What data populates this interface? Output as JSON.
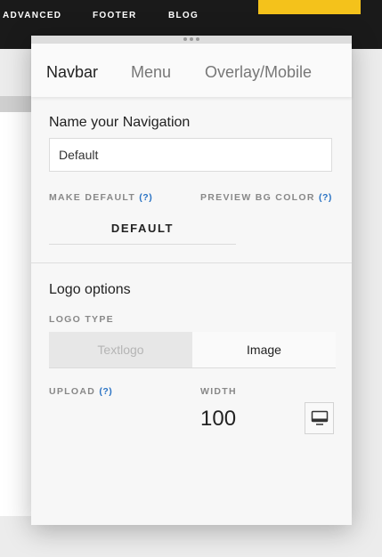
{
  "background": {
    "nav_items": [
      "ADVANCED",
      "FOOTER",
      "BLOG"
    ],
    "accent_color": "#f4c21b",
    "topbar_color": "#1a1a1a"
  },
  "panel": {
    "tabs": [
      {
        "label": "Navbar",
        "active": true
      },
      {
        "label": "Menu",
        "active": false
      },
      {
        "label": "Overlay/Mobile",
        "active": false
      }
    ],
    "navigation": {
      "heading": "Name your Navigation",
      "name_value": "Default",
      "make_default_label": "MAKE DEFAULT",
      "preview_bg_label": "PREVIEW BG COLOR",
      "help_text": "(?)",
      "default_button_label": "DEFAULT"
    },
    "logo": {
      "heading": "Logo options",
      "logo_type_label": "LOGO TYPE",
      "options": [
        {
          "label": "Textlogo",
          "selected": false
        },
        {
          "label": "Image",
          "selected": true
        }
      ],
      "upload_label": "UPLOAD",
      "help_text": "(?)",
      "width_label": "WIDTH",
      "width_value": "100",
      "device_icon": "desktop-monitor-icon"
    },
    "help_color": "#2a73c4"
  }
}
